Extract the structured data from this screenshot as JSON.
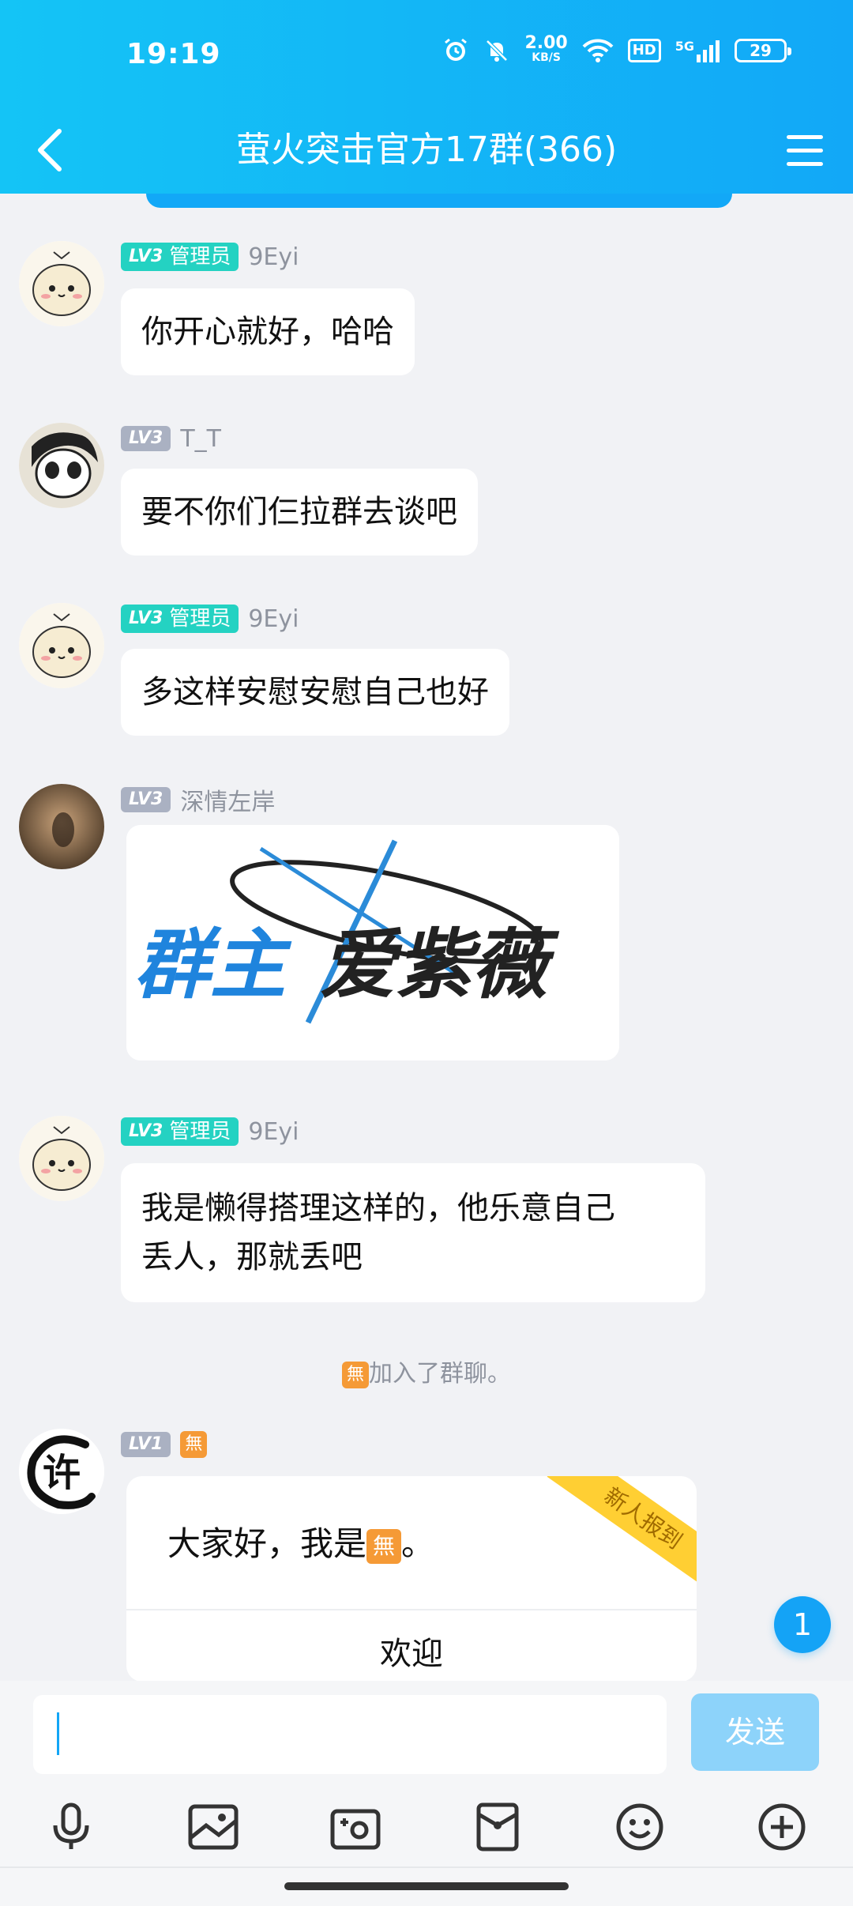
{
  "status_bar": {
    "time": "19:19",
    "net_speed_value": "2.00",
    "net_speed_unit": "KB/S",
    "hd": "HD",
    "signal": "5G",
    "battery": "29"
  },
  "nav": {
    "title": "萤火突击官方17群(366)"
  },
  "messages": [
    {
      "level": "LV3",
      "role": "管理员",
      "name": "9Eyi",
      "text": "你开心就好，哈哈"
    },
    {
      "level": "LV3",
      "name": "T_T",
      "text": "要不你们仨拉群去谈吧"
    },
    {
      "level": "LV3",
      "role": "管理员",
      "name": "9Eyi",
      "text": "多这样安慰安慰自己也好"
    },
    {
      "level": "LV3",
      "name": "深情左岸",
      "image_text_left": "群主",
      "image_text_right": "爱紫薇"
    },
    {
      "level": "LV3",
      "role": "管理员",
      "name": "9Eyi",
      "text_line1": "我是懒得搭理这样的，他乐意自己",
      "text_line2": "丢人，那就丢吧"
    }
  ],
  "system_note": {
    "emoji": "無",
    "text": "加入了群聊。"
  },
  "newcomer": {
    "level": "LV1",
    "name_emoji": "無",
    "avatar_char": "许",
    "greeting_prefix": "大家好，我是",
    "greeting_emoji": "無",
    "greeting_suffix": "。",
    "ribbon": "新人报到",
    "welcome_button": "欢迎"
  },
  "unread_count": "1",
  "composer": {
    "placeholder": "",
    "send_label": "发送"
  },
  "colors": {
    "header": "#14c4f6",
    "accent": "#14a3f6",
    "admin_badge": "#24d2c2",
    "level_badge": "#aab1c2",
    "send_disabled": "#8dd3fa"
  }
}
